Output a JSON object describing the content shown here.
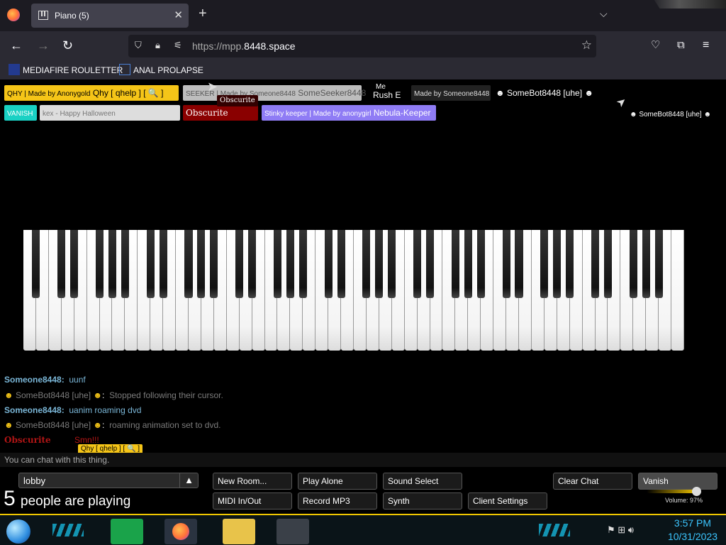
{
  "browser": {
    "tab_title": "Piano (5)",
    "new_tab": "+",
    "url_prefix": "https://mpp.",
    "url_domain": "8448.space",
    "bookmarks": [
      {
        "label": "MEDIAFIRE ROULETTER"
      },
      {
        "label": "ANAL PROLAPSE"
      }
    ]
  },
  "participants": [
    {
      "name": "QHY | Made by Anonygold",
      "bot": "Qhy [ qhelp ] [ 🔍 ]",
      "color": "#f5c518"
    },
    {
      "name": "SEEKER | Made by Someone8448",
      "bot": "SomeSeeker8448",
      "color": "#bdbdbd"
    },
    {
      "name": "Rush E",
      "tag": "Me"
    },
    {
      "name": "Made by Someone8448",
      "bot": "SomeBot8448 [uhe]"
    },
    {
      "name": "VANISH",
      "color": "#19d1c4"
    },
    {
      "name": "kex - Happy Halloween",
      "color": "#dddddd"
    },
    {
      "name": "Obscurite",
      "color": "#8a0000"
    },
    {
      "name": "Stinky keeper | Made by anonygirl",
      "bot": "Nebula-Keeper",
      "color": "#8f7cf5"
    }
  ],
  "cursor_labels": {
    "obscurite_top": "Obscurite",
    "somebot_right": "SomeBot8448 [uhe]",
    "qhy_bottom": "Qhy [ qhelp ] [ 🔍 ]"
  },
  "chat": [
    {
      "name": "Someone8448:",
      "message": "uunf",
      "name_color": "#7bb7d8"
    },
    {
      "name": "SomeBot8448 [uhe]",
      "message": "Stopped following their cursor.",
      "name_color": "#7b7b7b"
    },
    {
      "name": "Someone8448:",
      "message": "uanim roaming dvd",
      "name_color": "#7bb7d8"
    },
    {
      "name": "SomeBot8448 [uhe]",
      "message": "roaming animation set to dvd.",
      "name_color": "#7b7b7b"
    },
    {
      "name": "Obscurite",
      "message": "Smn!!!",
      "name_color": "#b01515"
    }
  ],
  "chat_input_placeholder": "You can chat with this thing.",
  "room": {
    "name": "lobby",
    "arrow": "▲"
  },
  "player_count": "5",
  "player_count_label": "people are playing",
  "buttons": {
    "new_room": "New Room...",
    "play_alone": "Play Alone",
    "sound_select": "Sound Select",
    "clear_chat": "Clear Chat",
    "vanish": "Vanish",
    "midi": "MIDI In/Out",
    "record_mp3": "Record MP3",
    "synth": "Synth",
    "client_settings": "Client Settings"
  },
  "volume": {
    "label": "Volume: 97%",
    "value": 0.97
  },
  "taskbar": {
    "time": "3:57 PM",
    "date": "10/31/2023"
  },
  "icons": [
    "firefox-icon",
    "back-icon",
    "forward-icon",
    "reload-icon",
    "shield-icon",
    "lock-icon",
    "permissions-icon",
    "star-icon",
    "pocket-icon",
    "extensions-icon",
    "menu-icon",
    "windows-start-icon",
    "folder-icon",
    "speaker-icon"
  ]
}
